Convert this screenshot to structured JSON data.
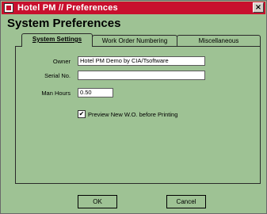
{
  "window": {
    "title": "Hotel PM // Preferences",
    "close_glyph": "×"
  },
  "heading": "System Preferences",
  "tabs": [
    {
      "label": "System Settings",
      "active": true
    },
    {
      "label": "Work Order Numbering",
      "active": false
    },
    {
      "label": "Miscellaneous",
      "active": false
    }
  ],
  "form": {
    "owner_label": "Owner",
    "owner_value": "Hotel PM Demo by CIA/Tsoftware",
    "serial_label": "Serial No.",
    "serial_value": "",
    "man_hours_label": "Man Hours",
    "man_hours_value": "0.50",
    "preview_checked": true,
    "preview_label": "Preview New W.O. before Printing",
    "check_glyph": "✔"
  },
  "buttons": {
    "ok": "OK",
    "cancel": "Cancel"
  },
  "colors": {
    "window_bg": "#9ec294",
    "titlebar": "#c8102e"
  }
}
